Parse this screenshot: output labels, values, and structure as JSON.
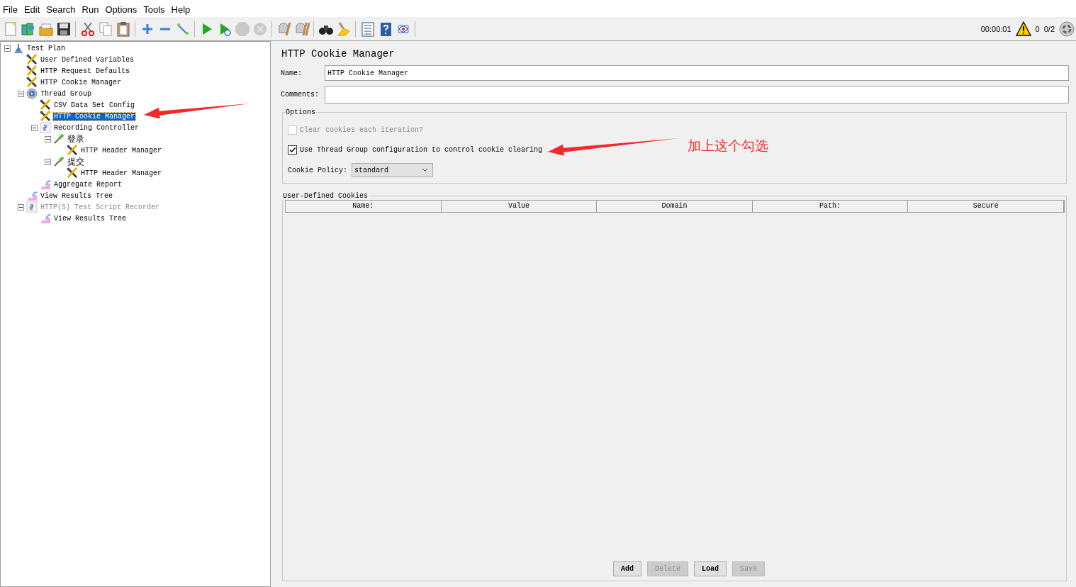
{
  "menu": [
    "File",
    "Edit",
    "Search",
    "Run",
    "Options",
    "Tools",
    "Help"
  ],
  "toolbar": [
    [
      {
        "kind": "new",
        "disabled": false
      },
      {
        "kind": "templates",
        "disabled": false
      },
      {
        "kind": "open",
        "disabled": false
      },
      {
        "kind": "save",
        "disabled": false
      }
    ],
    [
      {
        "kind": "cut",
        "disabled": false
      },
      {
        "kind": "copy",
        "disabled": false
      },
      {
        "kind": "paste",
        "disabled": false
      }
    ],
    [
      {
        "kind": "expand",
        "disabled": false
      },
      {
        "kind": "collapse",
        "disabled": false
      },
      {
        "kind": "toggle",
        "disabled": false
      }
    ],
    [
      {
        "kind": "start",
        "disabled": false
      },
      {
        "kind": "start-no-pause",
        "disabled": false
      },
      {
        "kind": "stop",
        "disabled": true
      },
      {
        "kind": "shutdown",
        "disabled": true
      }
    ],
    [
      {
        "kind": "clear",
        "disabled": false
      },
      {
        "kind": "clear-all",
        "disabled": false
      }
    ],
    [
      {
        "kind": "search",
        "disabled": false
      },
      {
        "kind": "reset-search",
        "disabled": false
      }
    ],
    [
      {
        "kind": "function-helper",
        "disabled": false
      },
      {
        "kind": "help",
        "disabled": false
      },
      {
        "kind": "log",
        "disabled": false
      }
    ]
  ],
  "status": {
    "elapsed": "00:00:01",
    "warnings": "0",
    "threads": "0/2"
  },
  "tree": [
    {
      "label": "Test Plan",
      "kind": "plan",
      "expanded": true,
      "selected": false,
      "disabled": false,
      "children": [
        {
          "label": "User Defined Variables",
          "kind": "config",
          "selected": false,
          "disabled": false
        },
        {
          "label": "HTTP Request Defaults",
          "kind": "config",
          "selected": false,
          "disabled": false
        },
        {
          "label": "HTTP Cookie Manager",
          "kind": "config",
          "selected": false,
          "disabled": false
        },
        {
          "label": "Thread Group",
          "kind": "threads",
          "expanded": true,
          "selected": false,
          "disabled": false,
          "children": [
            {
              "label": "CSV Data Set Config",
              "kind": "config",
              "selected": false,
              "disabled": false
            },
            {
              "label": "HTTP Cookie Manager",
              "kind": "config",
              "selected": true,
              "disabled": false
            },
            {
              "label": "Recording Controller",
              "kind": "controller",
              "expanded": true,
              "selected": false,
              "disabled": false,
              "children": [
                {
                  "label": "登录",
                  "kind": "sampler",
                  "expanded": true,
                  "selected": false,
                  "disabled": false,
                  "children": [
                    {
                      "label": "HTTP Header Manager",
                      "kind": "config",
                      "selected": false,
                      "disabled": false
                    }
                  ]
                },
                {
                  "label": "提交",
                  "kind": "sampler",
                  "expanded": true,
                  "selected": false,
                  "disabled": false,
                  "children": [
                    {
                      "label": "HTTP Header Manager",
                      "kind": "config",
                      "selected": false,
                      "disabled": false
                    }
                  ]
                }
              ]
            },
            {
              "label": "Aggregate Report",
              "kind": "listener",
              "selected": false,
              "disabled": false
            }
          ]
        },
        {
          "label": "View Results Tree",
          "kind": "listener",
          "selected": false,
          "disabled": false
        },
        {
          "label": "HTTP(S) Test Script Recorder",
          "kind": "controller",
          "expanded": true,
          "selected": false,
          "disabled": true,
          "children": [
            {
              "label": "View Results Tree",
              "kind": "listener",
              "selected": false,
              "disabled": false
            }
          ]
        }
      ]
    }
  ],
  "editor": {
    "title": "HTTP Cookie Manager",
    "name_label": "Name:",
    "name_value": "HTTP Cookie Manager",
    "comments_label": "Comments:",
    "options": {
      "legend": "Options",
      "checkboxes": [
        {
          "label": "Clear cookies each iteration?",
          "checked": false,
          "disabled": true
        },
        {
          "label": "Use Thread Group configuration to control cookie clearing",
          "checked": true,
          "disabled": false
        }
      ],
      "policy_label": "Cookie Policy:",
      "policy_value": "standard"
    },
    "cookies": {
      "legend": "User-Defined Cookies",
      "columns": [
        "Name:",
        "Value",
        "Domain",
        "Path:",
        "Secure"
      ],
      "buttons": [
        {
          "label": "Add",
          "disabled": false
        },
        {
          "label": "Delete",
          "disabled": true
        },
        {
          "label": "Load",
          "disabled": false
        },
        {
          "label": "Save",
          "disabled": true
        }
      ]
    }
  },
  "annotation": {
    "note": "加上这个勾选"
  }
}
